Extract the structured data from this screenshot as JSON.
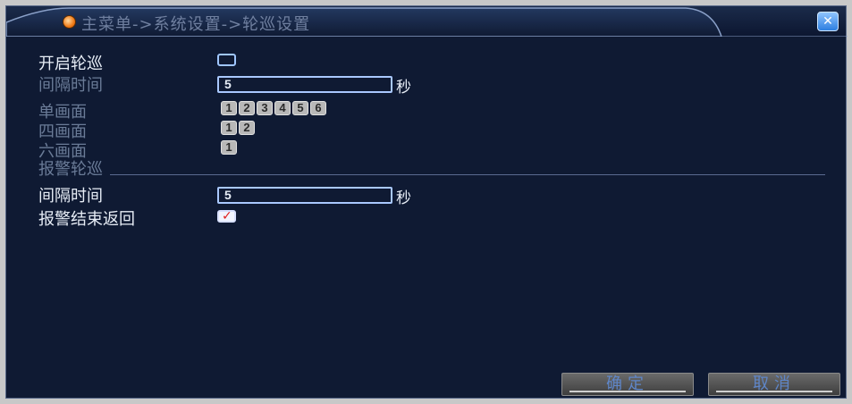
{
  "window": {
    "title": "主菜单->系统设置->轮巡设置",
    "close_icon": "close-icon",
    "colors": {
      "background": "#0f1a33",
      "accent": "#9fc6ff",
      "title_dot": "#f07a16"
    }
  },
  "tour": {
    "enable_label": "开启轮巡",
    "enable_checked": false,
    "interval_label": "间隔时间",
    "interval_value": "5",
    "interval_unit": "秒",
    "single_view_label": "单画面",
    "single_view_channels": [
      "1",
      "2",
      "3",
      "4",
      "5",
      "6"
    ],
    "quad_view_label": "四画面",
    "quad_view_channels": [
      "1",
      "2"
    ],
    "six_view_label": "六画面",
    "six_view_channels": [
      "1"
    ]
  },
  "alarm_tour": {
    "section_label": "报警轮巡",
    "interval_label": "间隔时间",
    "interval_value": "5",
    "interval_unit": "秒",
    "return_label": "报警结束返回",
    "return_checked": true
  },
  "buttons": {
    "ok_label": "确定",
    "cancel_label": "取消"
  }
}
